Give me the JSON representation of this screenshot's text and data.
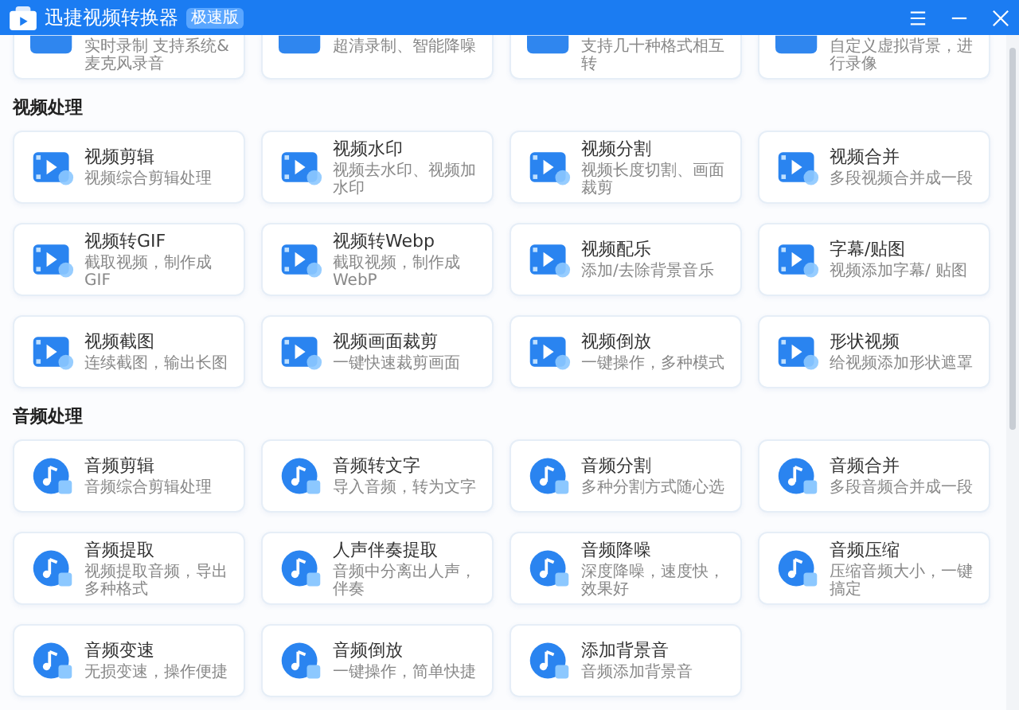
{
  "window": {
    "title": "迅捷视频转换器",
    "badge": "极速版"
  },
  "top_row": [
    {
      "description": "实时录制 支持系统&麦克风录音"
    },
    {
      "description": "超清录制、智能降噪"
    },
    {
      "description": "支持几十种格式相互转"
    },
    {
      "description": "自定义虚拟背景，进行录像"
    }
  ],
  "sections": [
    {
      "title": "视频处理",
      "kind": "video",
      "tools": [
        {
          "title": "视频剪辑",
          "description": "视频综合剪辑处理"
        },
        {
          "title": "视频水印",
          "description": "视频去水印、视频加水印"
        },
        {
          "title": "视频分割",
          "description": "视频长度切割、画面裁剪"
        },
        {
          "title": "视频合并",
          "description": "多段视频合并成一段"
        },
        {
          "title": "视频转GIF",
          "description": "截取视频，制作成GIF"
        },
        {
          "title": "视频转Webp",
          "description": "截取视频，制作成WebP"
        },
        {
          "title": "视频配乐",
          "description": "添加/去除背景音乐"
        },
        {
          "title": "字幕/贴图",
          "description": "视频添加字幕/ 贴图"
        },
        {
          "title": "视频截图",
          "description": "连续截图，输出长图"
        },
        {
          "title": "视频画面裁剪",
          "description": "一键快速裁剪画面"
        },
        {
          "title": "视频倒放",
          "description": "一键操作，多种模式"
        },
        {
          "title": "形状视频",
          "description": "给视频添加形状遮罩"
        }
      ]
    },
    {
      "title": "音频处理",
      "kind": "audio",
      "tools": [
        {
          "title": "音频剪辑",
          "description": "音频综合剪辑处理"
        },
        {
          "title": "音频转文字",
          "description": "导入音频，转为文字"
        },
        {
          "title": "音频分割",
          "description": "多种分割方式随心选"
        },
        {
          "title": "音频合并",
          "description": "多段音频合并成一段"
        },
        {
          "title": "音频提取",
          "description": "视频提取音频，导出多种格式"
        },
        {
          "title": "人声伴奏提取",
          "description": "音频中分离出人声，伴奏"
        },
        {
          "title": "音频降噪",
          "description": "深度降噪，速度快，效果好"
        },
        {
          "title": "音频压缩",
          "description": "压缩音频大小，一键搞定"
        },
        {
          "title": "音频变速",
          "description": "无损变速，操作便捷"
        },
        {
          "title": "音频倒放",
          "description": "一键操作，简单快捷"
        },
        {
          "title": "添加背景音",
          "description": "音频添加背景音"
        }
      ]
    }
  ]
}
